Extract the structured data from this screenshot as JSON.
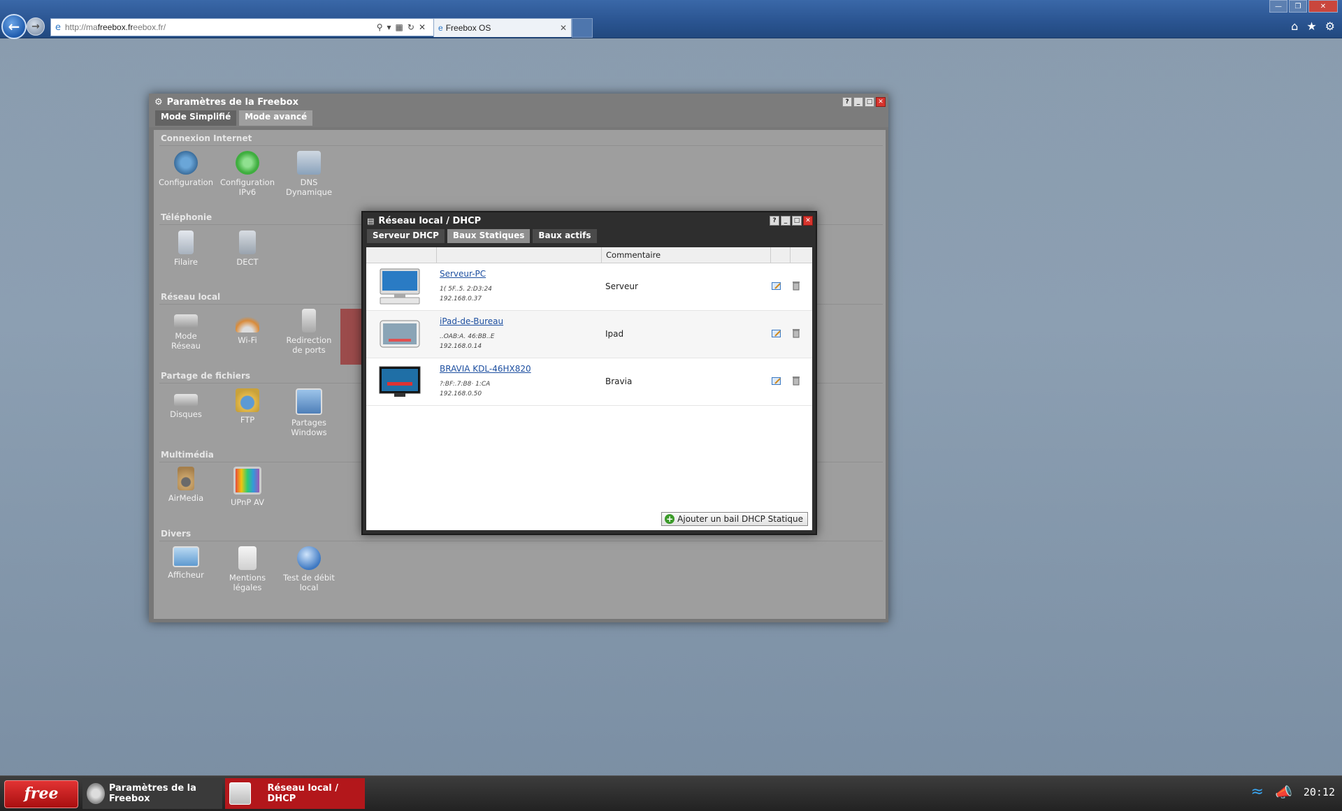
{
  "browser": {
    "url_prefix": "http://ma",
    "url_domain": "freebox.fr",
    "url_suffix": "eebox.fr/",
    "tab_title": "Freebox OS"
  },
  "param_window": {
    "title": "Paramètres de la Freebox",
    "tabs": [
      "Mode Simplifié",
      "Mode avancé"
    ],
    "sections": {
      "internet": "Connexion Internet",
      "telephonie": "Téléphonie",
      "reseau": "Réseau local",
      "partage": "Partage de fichiers",
      "multimedia": "Multimédia",
      "divers": "Divers"
    },
    "items": {
      "configuration": "Configuration",
      "config_ipv6_1": "Configuration",
      "config_ipv6_2": "IPv6",
      "dns_1": "DNS",
      "dns_2": "Dynamique",
      "filaire": "Filaire",
      "dect": "DECT",
      "mode_reseau_1": "Mode",
      "mode_reseau_2": "Réseau",
      "wifi": "Wi-Fi",
      "redirection_1": "Redirection",
      "redirection_2": "de ports",
      "disques": "Disques",
      "ftp": "FTP",
      "partages_1": "Partages",
      "partages_2": "Windows",
      "airmedia": "AirMedia",
      "upnp": "UPnP AV",
      "afficheur": "Afficheur",
      "mentions_1": "Mentions",
      "mentions_2": "légales",
      "test_1": "Test de débit",
      "test_2": "local"
    }
  },
  "dhcp_window": {
    "title": "Réseau local / DHCP",
    "tabs": [
      "Serveur DHCP",
      "Baux Statiques",
      "Baux actifs"
    ],
    "column_comment": "Commentaire",
    "leases": [
      {
        "name": "Serveur-PC",
        "mac": "1( 5F..5. 2:D3:24",
        "ip": "192.168.0.37",
        "comment": "Serveur"
      },
      {
        "name": "iPad-de-Bureau",
        "mac": "..OAB:A. 46:BB..E",
        "ip": "192.168.0.14",
        "comment": "Ipad"
      },
      {
        "name": "BRAVIA KDL-46HX820",
        "mac": "?:BF:.7:B8· 1:CA",
        "ip": "192.168.0.50",
        "comment": "Bravia"
      }
    ],
    "add_button": "Ajouter un bail DHCP Statique"
  },
  "taskbar": {
    "free_logo": "free",
    "task_param": "Paramètres de la Freebox",
    "task_dhcp": "Réseau local / DHCP",
    "clock": "20:12"
  }
}
